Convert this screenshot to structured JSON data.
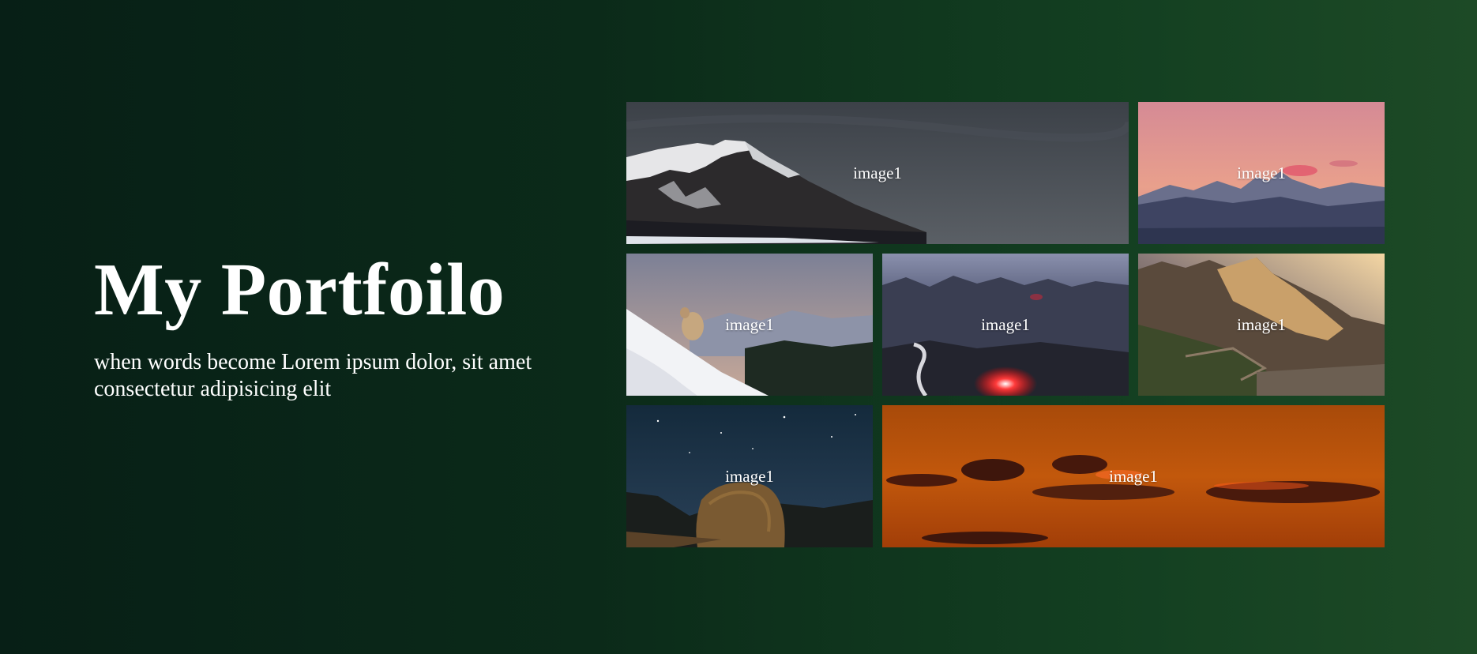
{
  "hero": {
    "title": "My Portfoilo",
    "subtitle": "when words become Lorem ipsum dolor, sit amet consectetur adipisicing elit"
  },
  "gallery": {
    "tiles": [
      {
        "label": "image1",
        "scene": "snowy mountain under grey clouds"
      },
      {
        "label": "image1",
        "scene": "pink sunset over mountain range"
      },
      {
        "label": "image1",
        "scene": "sheep on snowy slope"
      },
      {
        "label": "image1",
        "scene": "night mountains with red campfire"
      },
      {
        "label": "image1",
        "scene": "sunlit rocky cliffs"
      },
      {
        "label": "image1",
        "scene": "starry night over boulder"
      },
      {
        "label": "image1",
        "scene": "orange sunset clouds"
      }
    ]
  },
  "colors": {
    "background_start": "#071f16",
    "background_end": "#1d4a26",
    "text": "#ffffff"
  }
}
